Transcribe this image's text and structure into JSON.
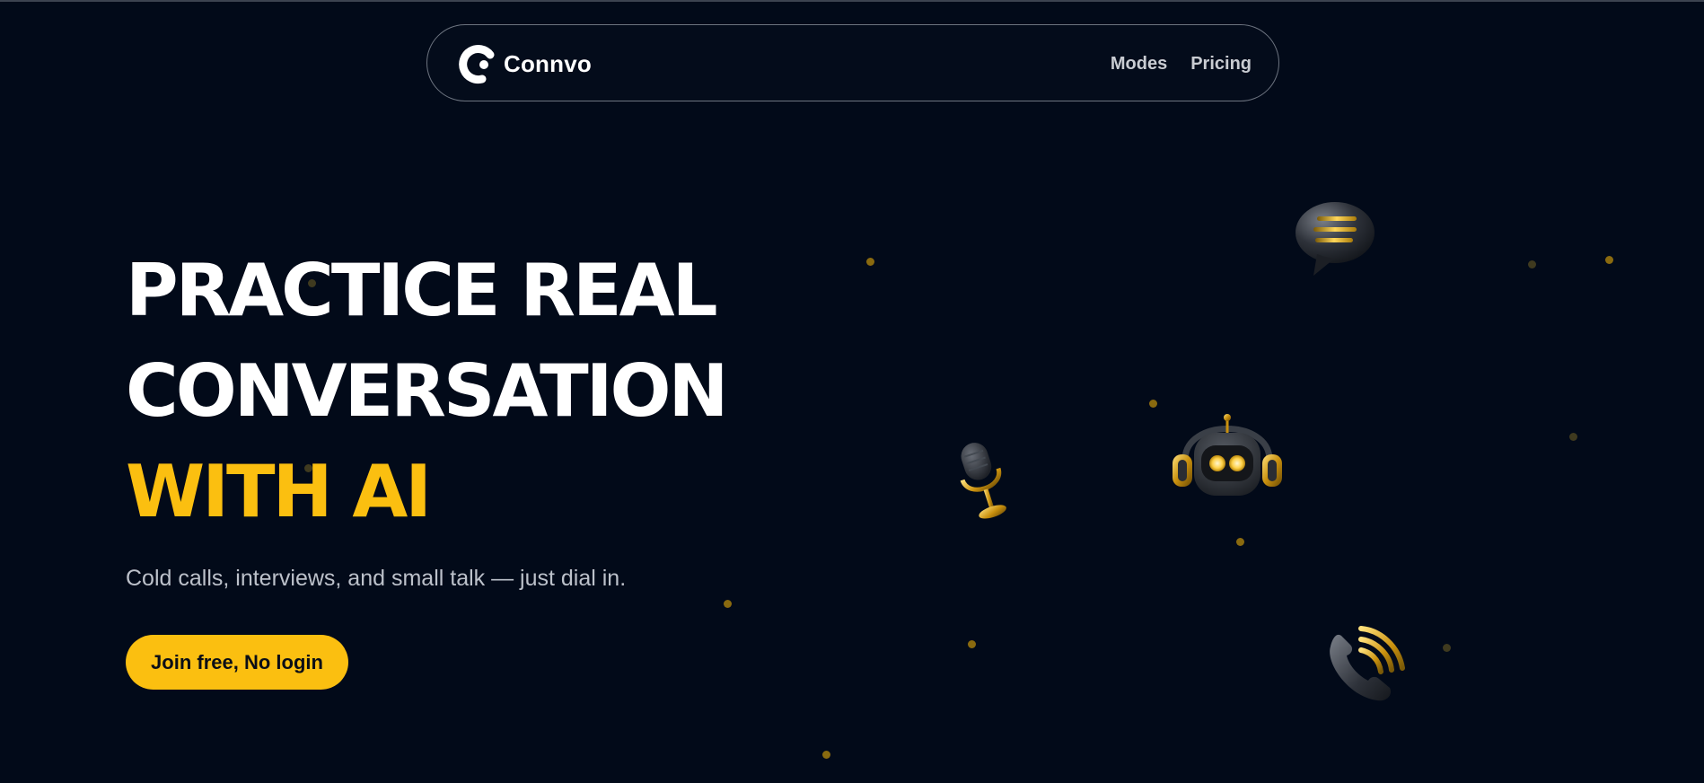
{
  "brand": {
    "name": "Connvo",
    "logo_icon": "connvo-logo-icon"
  },
  "nav": {
    "links": [
      {
        "label": "Modes"
      },
      {
        "label": "Pricing"
      }
    ]
  },
  "hero": {
    "title_line1": "PRACTICE REAL",
    "title_line2": "CONVERSATION",
    "title_line3": "WITH AI",
    "subtitle": "Cold calls, interviews, and small talk — just dial in.",
    "cta_label": "Join free, No login"
  },
  "illustrations": [
    {
      "icon": "chat-bubble-icon"
    },
    {
      "icon": "robot-headphones-icon"
    },
    {
      "icon": "microphone-icon"
    },
    {
      "icon": "phone-handset-icon"
    }
  ],
  "colors": {
    "background": "#020a19",
    "accent": "#fbbf10",
    "text": "#ffffff",
    "muted_text": "#bcc1ca",
    "nav_border": "#6d7480"
  }
}
